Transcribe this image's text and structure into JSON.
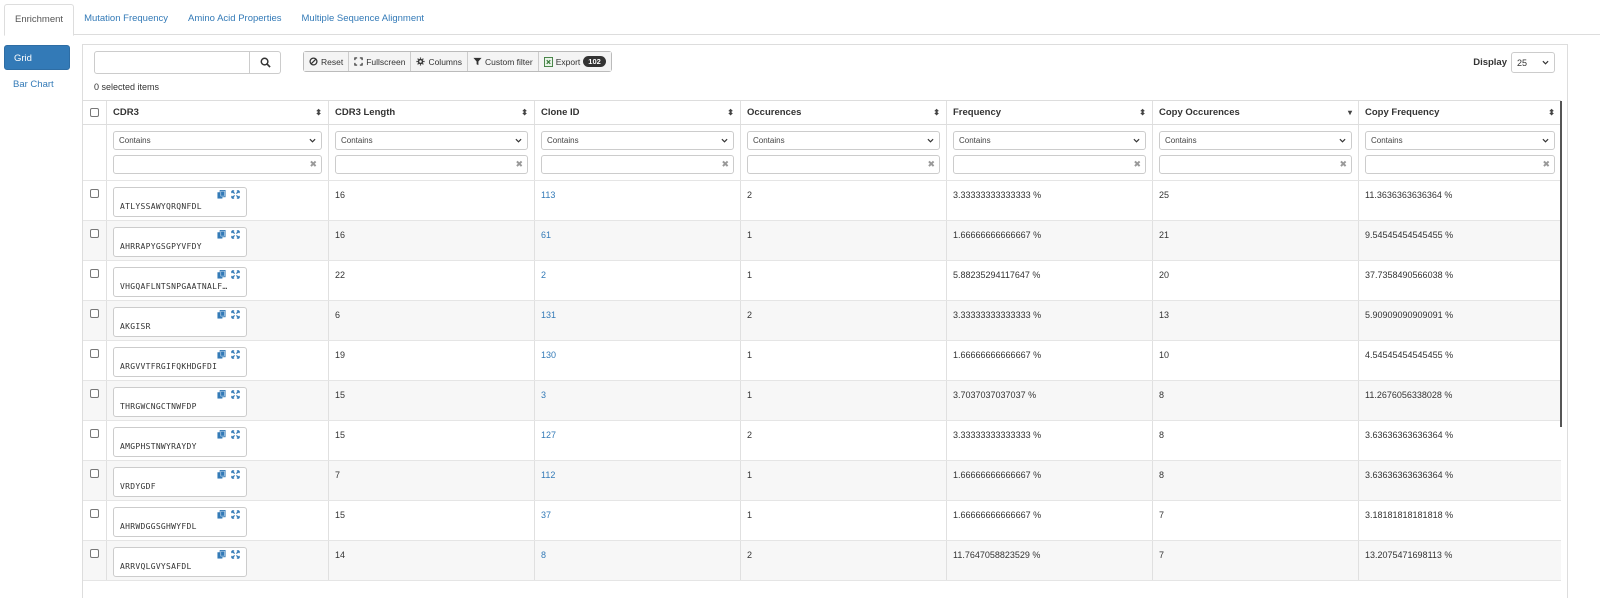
{
  "tabs": [
    "Enrichment",
    "Mutation Frequency",
    "Amino Acid Properties",
    "Multiple Sequence Alignment"
  ],
  "sidenav": {
    "grid_label": "Grid",
    "bar_chart_label": "Bar Chart"
  },
  "toolbar": {
    "search_value": "",
    "selected_text": "0 selected items",
    "reset": "Reset",
    "fullscreen": "Fullscreen",
    "columns": "Columns",
    "custom_filter": "Custom filter",
    "export": "Export",
    "export_count": "102",
    "display_label": "Display",
    "display_value": "25"
  },
  "columns": [
    "CDR3",
    "CDR3 Length",
    "Clone ID",
    "Occurences",
    "Frequency",
    "Copy Occurences",
    "Copy Frequency"
  ],
  "filter_option": "Contains",
  "rows": [
    {
      "cdr3": "ATLYSSAWYQRQNFDL",
      "len": "16",
      "clone": "113",
      "occ": "2",
      "freq": "3.33333333333333 %",
      "copy_occ": "25",
      "copy_freq": "11.3636363636364 %"
    },
    {
      "cdr3": "AHRRAPYGSGPYVFDY",
      "len": "16",
      "clone": "61",
      "occ": "1",
      "freq": "1.66666666666667 %",
      "copy_occ": "21",
      "copy_freq": "9.54545454545455 %"
    },
    {
      "cdr3": "VHGQAFLNTSNPGAATNALF…",
      "len": "22",
      "clone": "2",
      "occ": "1",
      "freq": "5.88235294117647 %",
      "copy_occ": "20",
      "copy_freq": "37.7358490566038 %"
    },
    {
      "cdr3": "AKGISR",
      "len": "6",
      "clone": "131",
      "occ": "2",
      "freq": "3.33333333333333 %",
      "copy_occ": "13",
      "copy_freq": "5.90909090909091 %"
    },
    {
      "cdr3": "ARGVVTFRGIFQKHDGFDI",
      "len": "19",
      "clone": "130",
      "occ": "1",
      "freq": "1.66666666666667 %",
      "copy_occ": "10",
      "copy_freq": "4.54545454545455 %"
    },
    {
      "cdr3": "THRGWCNGCTNWFDP",
      "len": "15",
      "clone": "3",
      "occ": "1",
      "freq": "3.7037037037037 %",
      "copy_occ": "8",
      "copy_freq": "11.2676056338028 %"
    },
    {
      "cdr3": "AMGPHSTNWYRAYDY",
      "len": "15",
      "clone": "127",
      "occ": "2",
      "freq": "3.33333333333333 %",
      "copy_occ": "8",
      "copy_freq": "3.63636363636364 %"
    },
    {
      "cdr3": "VRDYGDF",
      "len": "7",
      "clone": "112",
      "occ": "1",
      "freq": "1.66666666666667 %",
      "copy_occ": "8",
      "copy_freq": "3.63636363636364 %"
    },
    {
      "cdr3": "AHRWDGGSGHWYFDL",
      "len": "15",
      "clone": "37",
      "occ": "1",
      "freq": "1.66666666666667 %",
      "copy_occ": "7",
      "copy_freq": "3.18181818181818 %"
    },
    {
      "cdr3": "ARRVQLGVYSAFDL",
      "len": "14",
      "clone": "8",
      "occ": "2",
      "freq": "11.7647058823529 %",
      "copy_occ": "7",
      "copy_freq": "13.2075471698113 %"
    }
  ],
  "colors": {
    "accent": "#337ab7",
    "alt_row": "#f7f7f7"
  },
  "icons": [
    "search-icon",
    "reset-icon",
    "fullscreen-icon",
    "columns-icon",
    "filter-icon",
    "export-icon",
    "copy-icon",
    "expand-icon",
    "sort-icon",
    "clear-icon",
    "chevron-down-icon"
  ]
}
